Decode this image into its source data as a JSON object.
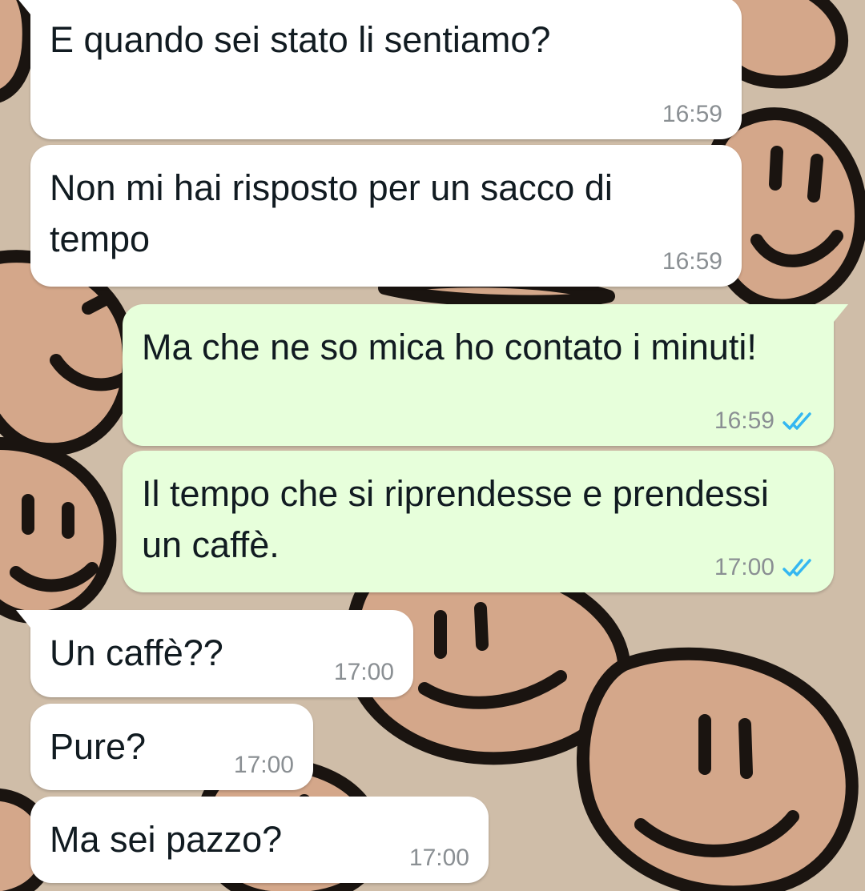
{
  "colors": {
    "incoming_bubble": "#ffffff",
    "outgoing_bubble": "#e7ffdb",
    "read_ticks": "#34b7f1",
    "wallpaper": "#cbb8a3"
  },
  "wallpaper": {
    "description": "smiley-faces-pattern"
  },
  "messages": [
    {
      "direction": "in",
      "text": "E quando sei stato li sentiamo?",
      "time": "16:59"
    },
    {
      "direction": "in",
      "text": "Non mi hai risposto per un sacco di tempo",
      "time": "16:59"
    },
    {
      "direction": "out",
      "text": "Ma che ne so mica ho contato i minuti!",
      "time": "16:59",
      "status": "read-double-check-icon"
    },
    {
      "direction": "out",
      "text": "Il tempo che si riprendesse e prendessi un caffè.",
      "time": "17:00",
      "status": "read-double-check-icon"
    },
    {
      "direction": "in",
      "text": "Un caffè??",
      "time": "17:00"
    },
    {
      "direction": "in",
      "text": "Pure?",
      "time": "17:00"
    },
    {
      "direction": "in",
      "text": "Ma sei pazzo?",
      "time": "17:00"
    }
  ]
}
